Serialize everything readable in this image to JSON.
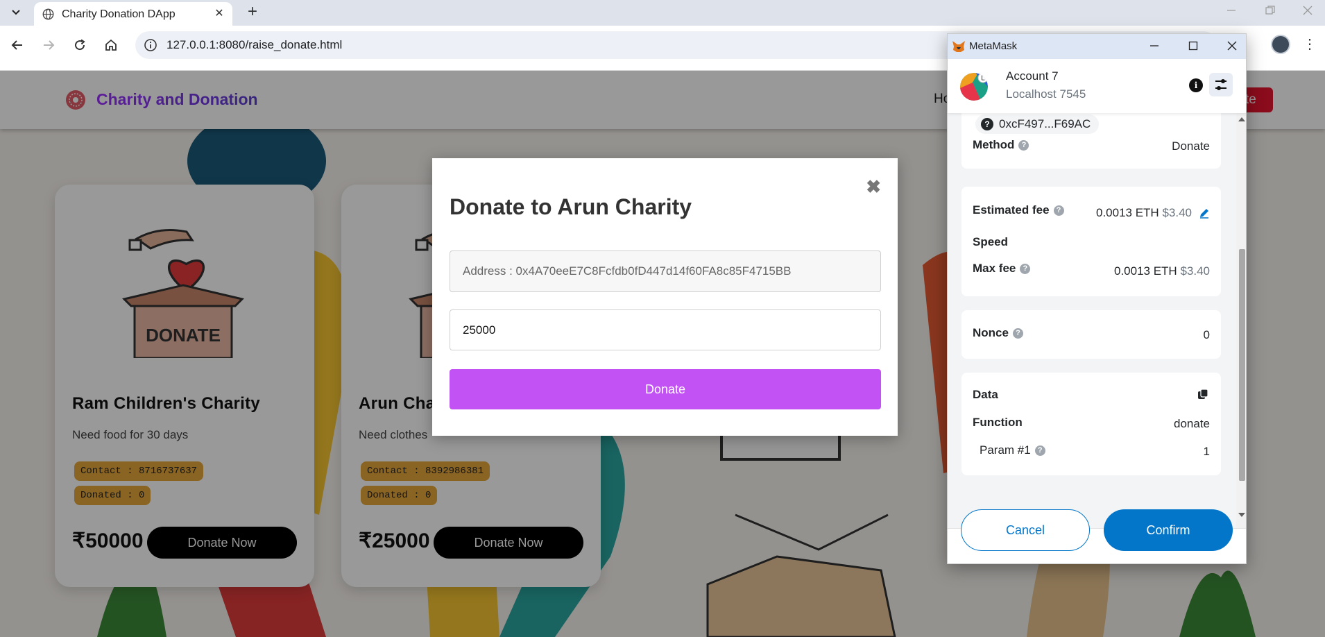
{
  "browser": {
    "tab_title": "Charity Donation DApp",
    "tab_close": "✕",
    "new_tab": "+",
    "url": "127.0.0.1:8080/raise_donate.html"
  },
  "site": {
    "brand": "Charity and Donation",
    "nav_home": "Ho",
    "header_cta": "te"
  },
  "cards": [
    {
      "title": "Ram Children's Charity",
      "description": "Need food for 30 days",
      "contact": "Contact : 8716737637",
      "donated": "Donated : 0",
      "price": "₹50000",
      "button": "Donate Now",
      "image_text": "DONATE"
    },
    {
      "title": "Arun Cha",
      "description": "Need clothes",
      "contact": "Contact : 8392986381",
      "donated": "Donated : 0",
      "price": "₹25000",
      "button": "Donate Now",
      "image_text": "D"
    }
  ],
  "modal": {
    "title": "Donate to Arun Charity",
    "close": "✖",
    "address": "Address : 0x4A70eeE7C8Fcfdb0fD447d14f60FA8c85F4715BB",
    "amount": "25000",
    "submit": "Donate"
  },
  "metamask": {
    "window_title": "MetaMask",
    "account_name": "Account 7",
    "network": "Localhost 7545",
    "avatar_letter": "L",
    "to_address": "0xcF497...F69AC",
    "method_label": "Method",
    "method_value": "Donate",
    "fee_label": "Estimated fee",
    "fee_eth": "0.0013 ETH",
    "fee_usd": "$3.40",
    "speed_label": "Speed",
    "max_fee_label": "Max fee",
    "max_fee_eth": "0.0013 ETH",
    "max_fee_usd": "$3.40",
    "nonce_label": "Nonce",
    "nonce_value": "0",
    "data_label": "Data",
    "function_label": "Function",
    "function_value": "donate",
    "param_label": "Param #1",
    "param_value": "1",
    "cancel": "Cancel",
    "confirm": "Confirm"
  },
  "colors": {
    "modal_button": "#c352f5",
    "metamask_primary": "#0376c9",
    "pill": "#e7a73b"
  }
}
